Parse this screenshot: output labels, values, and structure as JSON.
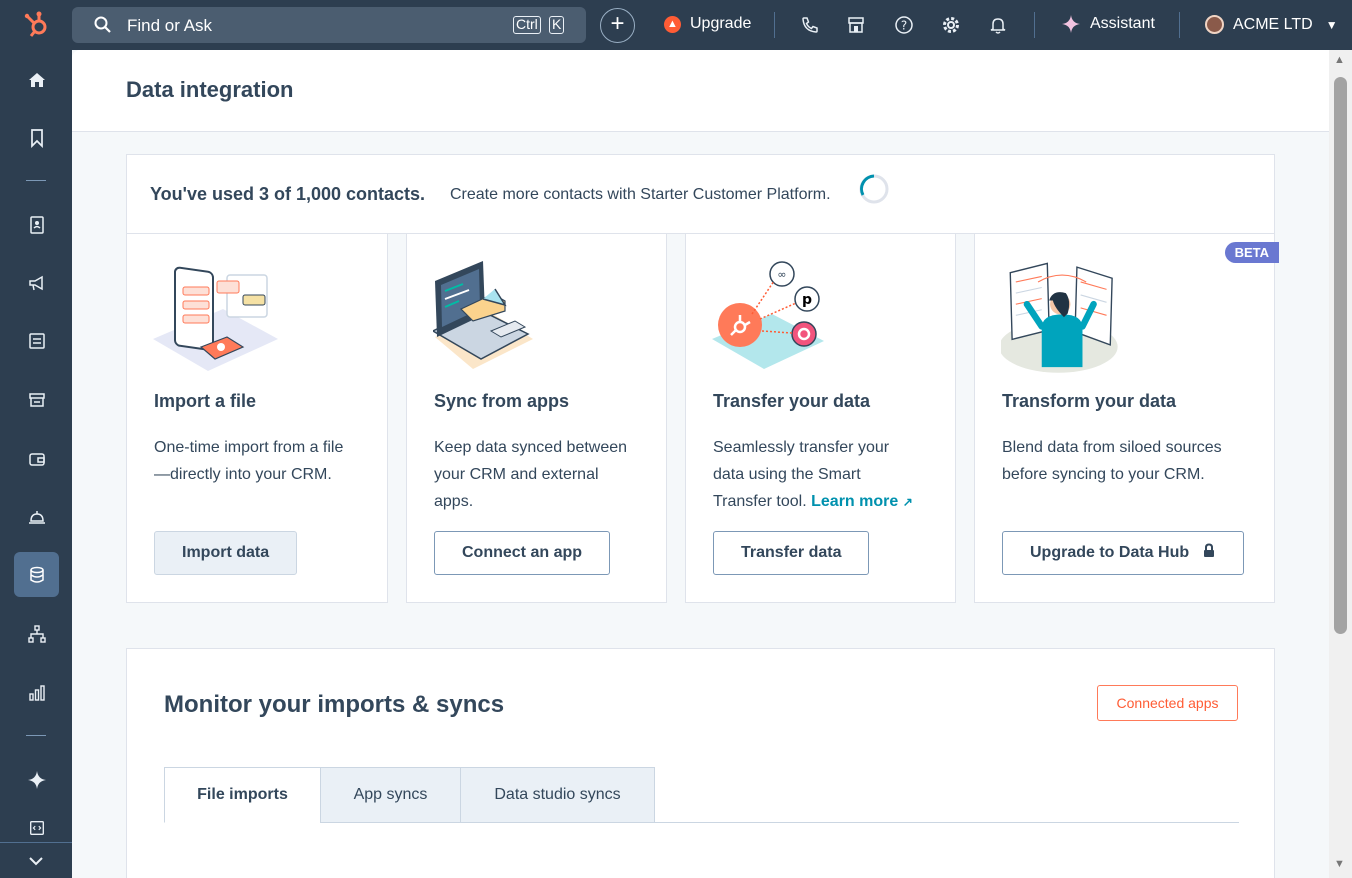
{
  "topbar": {
    "search_placeholder": "Find or Ask",
    "kbd_ctrl": "Ctrl",
    "kbd_k": "K",
    "add_label": "+",
    "upgrade_label": "Upgrade",
    "assistant_label": "Assistant",
    "account_name": "ACME LTD"
  },
  "page": {
    "title": "Data integration"
  },
  "usage": {
    "strong": "You've used 3 of 1,000 contacts.",
    "text": "Create more contacts with Starter Customer Platform."
  },
  "cards": [
    {
      "title": "Import a file",
      "desc_1": "One-time import from a file",
      "desc_2": "—directly into your CRM.",
      "button": "Import data"
    },
    {
      "title": "Sync from apps",
      "desc_1": "Keep data synced between",
      "desc_2": "your CRM and external",
      "desc_3": "apps.",
      "button": "Connect an app"
    },
    {
      "title": "Transfer your data",
      "desc_1": "Seamlessly transfer your",
      "desc_2": "data using the Smart",
      "desc_3": "Transfer tool.",
      "link": "Learn more",
      "button": "Transfer data"
    },
    {
      "title": "Transform your data",
      "desc_1": "Blend data from siloed sources",
      "desc_2": "before syncing to your CRM.",
      "button": "Upgrade to Data Hub",
      "badge": "BETA"
    }
  ],
  "monitor": {
    "title": "Monitor your imports & syncs",
    "connected_apps": "Connected apps",
    "tabs": [
      "File imports",
      "App syncs",
      "Data studio syncs"
    ]
  },
  "colors": {
    "nav_bg": "#2d3e50",
    "accent": "#ff5c35",
    "link": "#0091ae",
    "beta": "#6a78d1"
  }
}
